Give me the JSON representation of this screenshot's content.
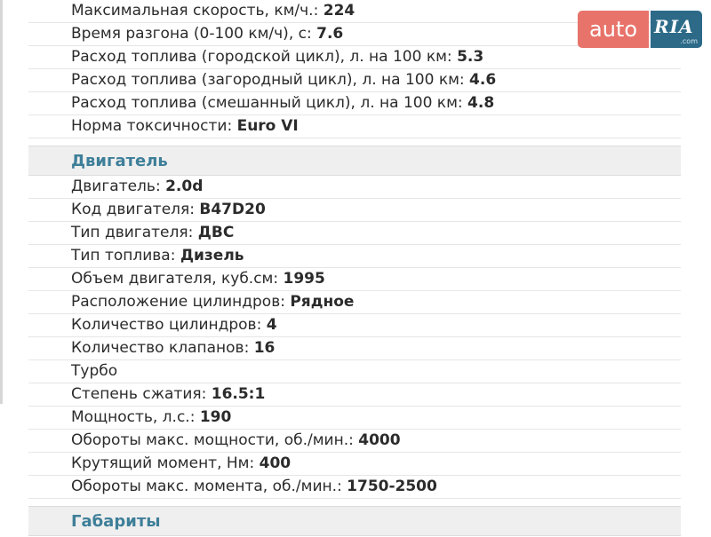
{
  "logo": {
    "auto": "auto",
    "ria": "RIA",
    "com": ".com"
  },
  "top_rows": [
    {
      "label": "Максимальная скорость, км/ч.: ",
      "value": "224"
    },
    {
      "label": "Время разгона (0-100 км/ч), с: ",
      "value": "7.6"
    },
    {
      "label": "Расход топлива (городской цикл), л. на 100 км: ",
      "value": "5.3"
    },
    {
      "label": "Расход топлива (загородный цикл), л. на 100 км: ",
      "value": "4.6"
    },
    {
      "label": "Расход топлива (смешанный цикл), л. на 100 км: ",
      "value": "4.8"
    },
    {
      "label": "Норма токсичности: ",
      "value": "Euro VI"
    }
  ],
  "engine": {
    "title": "Двигатель",
    "rows": [
      {
        "label": "Двигатель: ",
        "value": "2.0d"
      },
      {
        "label": "Код двигателя: ",
        "value": "B47D20"
      },
      {
        "label": "Тип двигателя: ",
        "value": "ДВС"
      },
      {
        "label": "Тип топлива: ",
        "value": "Дизель"
      },
      {
        "label": "Объем двигателя, куб.см: ",
        "value": "1995"
      },
      {
        "label": "Расположение цилиндров: ",
        "value": "Рядное"
      },
      {
        "label": "Количество цилиндров: ",
        "value": "4"
      },
      {
        "label": "Количество клапанов: ",
        "value": "16"
      },
      {
        "label": "Турбо",
        "value": ""
      },
      {
        "label": "Степень сжатия: ",
        "value": "16.5:1"
      },
      {
        "label": "Мощность, л.с.: ",
        "value": "190"
      },
      {
        "label": "Обороты макс. мощности, об./мин.: ",
        "value": "4000"
      },
      {
        "label": "Крутящий момент, Нм: ",
        "value": "400"
      },
      {
        "label": "Обороты макс. момента, об./мин.: ",
        "value": "1750-2500"
      }
    ]
  },
  "dimensions": {
    "title": "Габариты"
  }
}
